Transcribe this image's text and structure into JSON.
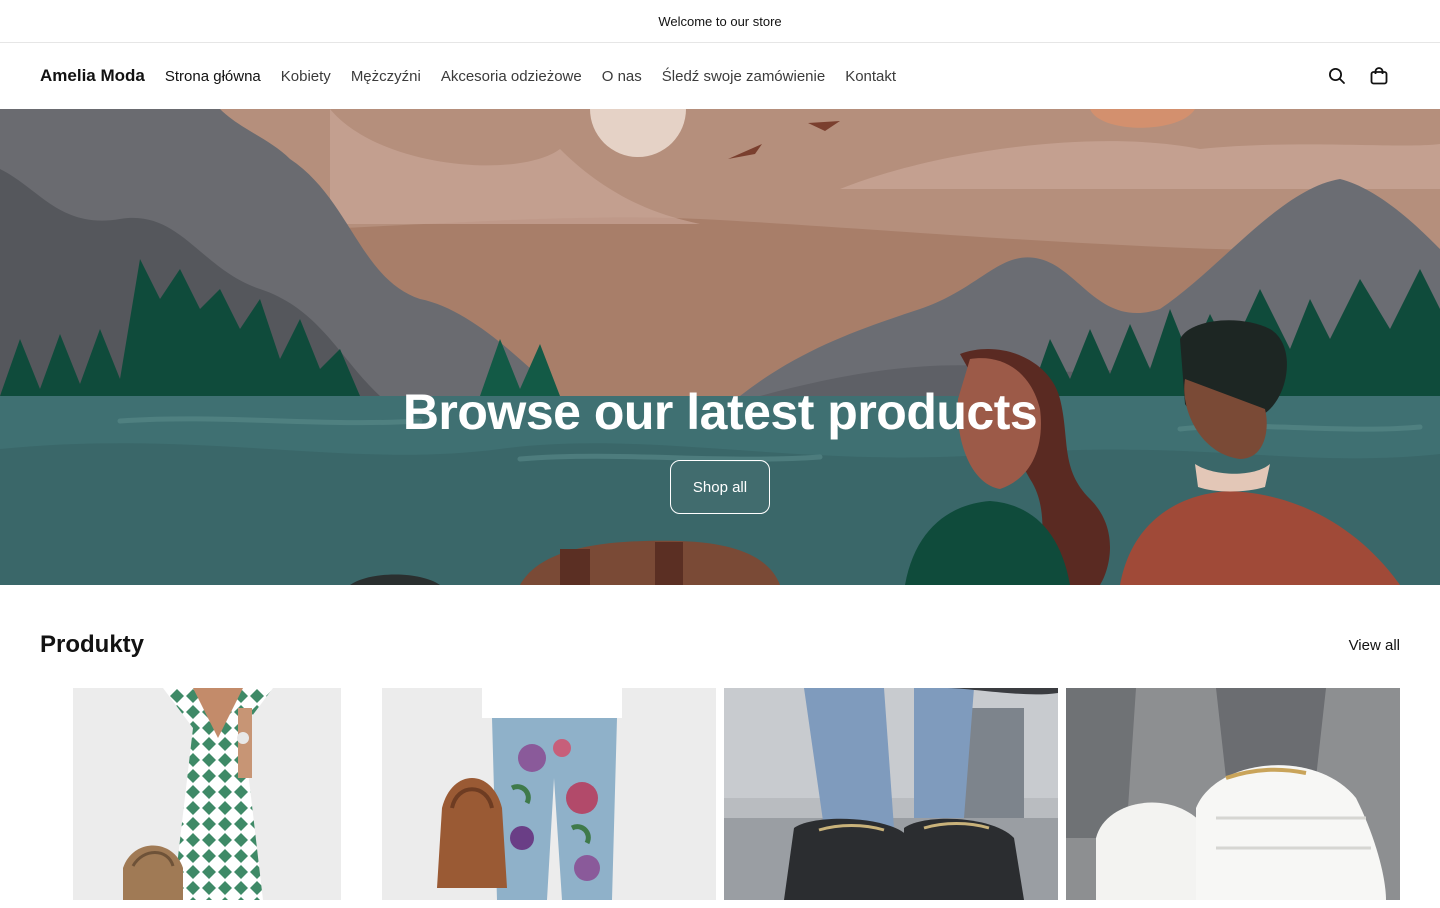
{
  "announcement": {
    "text": "Welcome to our store"
  },
  "header": {
    "logo": "Amelia Moda",
    "nav": [
      {
        "label": "Strona główna",
        "active": true
      },
      {
        "label": "Kobiety"
      },
      {
        "label": "Mężczyźni"
      },
      {
        "label": "Akcesoria odzieżowe"
      },
      {
        "label": "O nas"
      },
      {
        "label": "Śledź swoje zamówienie"
      },
      {
        "label": "Kontakt"
      }
    ],
    "icons": [
      "search-icon",
      "cart-icon"
    ]
  },
  "hero": {
    "title": "Browse our latest products",
    "button": "Shop all"
  },
  "products": {
    "title": "Produkty",
    "view_all": "View all",
    "items": [
      {
        "image": "green-patterned-dress"
      },
      {
        "image": "floral-print-jeans"
      },
      {
        "image": "black-sport-sneakers"
      },
      {
        "image": "white-sport-sneakers"
      }
    ]
  },
  "colors": {
    "hero_sky": "#a87e69",
    "hero_water": "#3f7072",
    "trees": "#0f4b3b",
    "mountains": "#5f6166"
  }
}
